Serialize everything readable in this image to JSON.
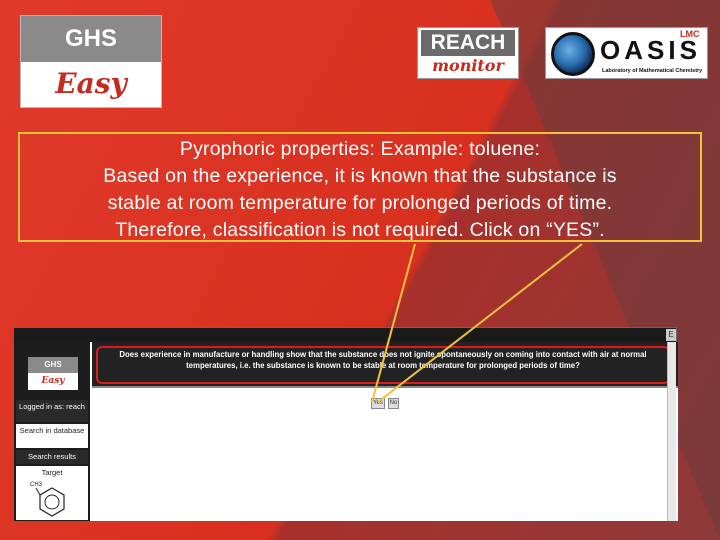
{
  "logos": {
    "ghs_top": "GHS",
    "ghs_bottom": "Easy",
    "reach_word": "REACH",
    "reach_sub": "monitor",
    "oasis_word": "OASIS",
    "oasis_lmc": "LMC",
    "oasis_sub": "Laboratory of Mathematical Chemistry"
  },
  "caption": {
    "line1": "Pyrophoric properties: Example: toluene:",
    "line2": "Based on the experience, it is known that the substance is",
    "line3": "stable at room temperature for prolonged periods of time.",
    "line4": "Therefore, classification is not required. Click on “YES”."
  },
  "screenshot": {
    "ghs_top": "GHS",
    "ghs_bottom": "Easy",
    "logged_in": "Logged in as: reach",
    "search_db": "Search in database",
    "search_results": "Search results",
    "target": "Target",
    "structure_label": "CH3",
    "question": "Does experience in manufacture or handling show that the substance does not ignite spontaneously on coming into contact with air at normal temperatures, i.e. the substance is known to be stable at room temperature for prolonged periods of time?",
    "yes_label": "Yes",
    "no_label": "No",
    "corner_button": "E"
  },
  "colors": {
    "background": "#c8291d",
    "highlight_box": "#f2c23a",
    "question_outline": "#e01a1a",
    "arrow": "#f2c23a"
  }
}
